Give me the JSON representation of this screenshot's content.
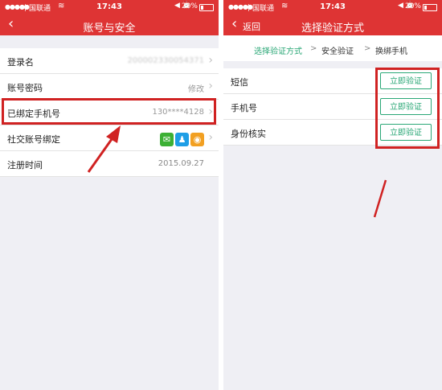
{
  "colors": {
    "brand": "#de3434",
    "accent": "#2aa776",
    "highlight": "#d02222"
  },
  "left": {
    "status": {
      "signal": "●●●●●",
      "carrier": "中国联通",
      "wifi": "wifi-icon",
      "time": "17:43",
      "icons": "◀ ⏰",
      "battery": "20%"
    },
    "nav": {
      "title": "账号与安全"
    },
    "rows": [
      {
        "label": "登录名",
        "value": "200002330054371"
      },
      {
        "label": "账号密码",
        "value": "修改"
      },
      {
        "label": "已绑定手机号",
        "value": "130****4128"
      },
      {
        "label": "社交账号绑定",
        "value": ""
      },
      {
        "label": "注册时间",
        "value": "2015.09.27"
      }
    ],
    "social_icons": [
      "wechat-icon",
      "qq-icon",
      "weibo-icon"
    ]
  },
  "right": {
    "status": {
      "signal": "●●●●●",
      "carrier": "中国联通",
      "wifi": "wifi-icon",
      "time": "17:43",
      "icons": "◀ ⏰",
      "battery": "20%"
    },
    "nav": {
      "back_label": "返回",
      "title": "选择验证方式"
    },
    "breadcrumbs": {
      "step1": "选择验证方式",
      "sep": ">",
      "step2": "安全验证",
      "step3": "换绑手机"
    },
    "methods": [
      {
        "label": "短信",
        "button": "立即验证"
      },
      {
        "label": "手机号",
        "button": "立即验证"
      },
      {
        "label": "身份核实",
        "button": "立即验证"
      }
    ]
  }
}
